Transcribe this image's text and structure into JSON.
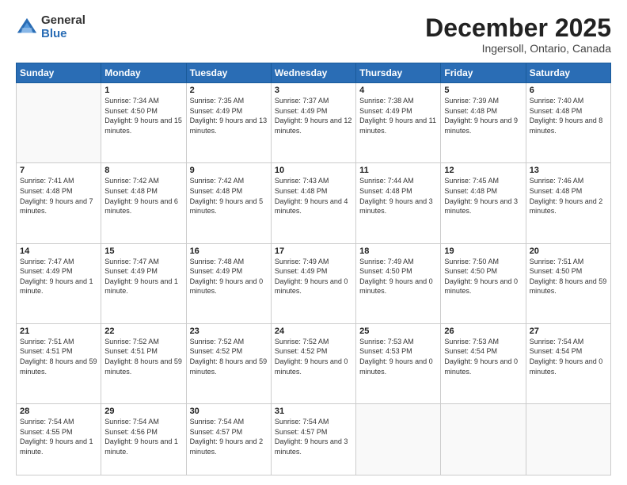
{
  "logo": {
    "general": "General",
    "blue": "Blue"
  },
  "title": "December 2025",
  "subtitle": "Ingersoll, Ontario, Canada",
  "weekdays": [
    "Sunday",
    "Monday",
    "Tuesday",
    "Wednesday",
    "Thursday",
    "Friday",
    "Saturday"
  ],
  "weeks": [
    [
      {
        "day": "",
        "sunrise": "",
        "sunset": "",
        "daylight": ""
      },
      {
        "day": "1",
        "sunrise": "Sunrise: 7:34 AM",
        "sunset": "Sunset: 4:50 PM",
        "daylight": "Daylight: 9 hours and 15 minutes."
      },
      {
        "day": "2",
        "sunrise": "Sunrise: 7:35 AM",
        "sunset": "Sunset: 4:49 PM",
        "daylight": "Daylight: 9 hours and 13 minutes."
      },
      {
        "day": "3",
        "sunrise": "Sunrise: 7:37 AM",
        "sunset": "Sunset: 4:49 PM",
        "daylight": "Daylight: 9 hours and 12 minutes."
      },
      {
        "day": "4",
        "sunrise": "Sunrise: 7:38 AM",
        "sunset": "Sunset: 4:49 PM",
        "daylight": "Daylight: 9 hours and 11 minutes."
      },
      {
        "day": "5",
        "sunrise": "Sunrise: 7:39 AM",
        "sunset": "Sunset: 4:48 PM",
        "daylight": "Daylight: 9 hours and 9 minutes."
      },
      {
        "day": "6",
        "sunrise": "Sunrise: 7:40 AM",
        "sunset": "Sunset: 4:48 PM",
        "daylight": "Daylight: 9 hours and 8 minutes."
      }
    ],
    [
      {
        "day": "7",
        "sunrise": "Sunrise: 7:41 AM",
        "sunset": "Sunset: 4:48 PM",
        "daylight": "Daylight: 9 hours and 7 minutes."
      },
      {
        "day": "8",
        "sunrise": "Sunrise: 7:42 AM",
        "sunset": "Sunset: 4:48 PM",
        "daylight": "Daylight: 9 hours and 6 minutes."
      },
      {
        "day": "9",
        "sunrise": "Sunrise: 7:42 AM",
        "sunset": "Sunset: 4:48 PM",
        "daylight": "Daylight: 9 hours and 5 minutes."
      },
      {
        "day": "10",
        "sunrise": "Sunrise: 7:43 AM",
        "sunset": "Sunset: 4:48 PM",
        "daylight": "Daylight: 9 hours and 4 minutes."
      },
      {
        "day": "11",
        "sunrise": "Sunrise: 7:44 AM",
        "sunset": "Sunset: 4:48 PM",
        "daylight": "Daylight: 9 hours and 3 minutes."
      },
      {
        "day": "12",
        "sunrise": "Sunrise: 7:45 AM",
        "sunset": "Sunset: 4:48 PM",
        "daylight": "Daylight: 9 hours and 3 minutes."
      },
      {
        "day": "13",
        "sunrise": "Sunrise: 7:46 AM",
        "sunset": "Sunset: 4:48 PM",
        "daylight": "Daylight: 9 hours and 2 minutes."
      }
    ],
    [
      {
        "day": "14",
        "sunrise": "Sunrise: 7:47 AM",
        "sunset": "Sunset: 4:49 PM",
        "daylight": "Daylight: 9 hours and 1 minute."
      },
      {
        "day": "15",
        "sunrise": "Sunrise: 7:47 AM",
        "sunset": "Sunset: 4:49 PM",
        "daylight": "Daylight: 9 hours and 1 minute."
      },
      {
        "day": "16",
        "sunrise": "Sunrise: 7:48 AM",
        "sunset": "Sunset: 4:49 PM",
        "daylight": "Daylight: 9 hours and 0 minutes."
      },
      {
        "day": "17",
        "sunrise": "Sunrise: 7:49 AM",
        "sunset": "Sunset: 4:49 PM",
        "daylight": "Daylight: 9 hours and 0 minutes."
      },
      {
        "day": "18",
        "sunrise": "Sunrise: 7:49 AM",
        "sunset": "Sunset: 4:50 PM",
        "daylight": "Daylight: 9 hours and 0 minutes."
      },
      {
        "day": "19",
        "sunrise": "Sunrise: 7:50 AM",
        "sunset": "Sunset: 4:50 PM",
        "daylight": "Daylight: 9 hours and 0 minutes."
      },
      {
        "day": "20",
        "sunrise": "Sunrise: 7:51 AM",
        "sunset": "Sunset: 4:50 PM",
        "daylight": "Daylight: 8 hours and 59 minutes."
      }
    ],
    [
      {
        "day": "21",
        "sunrise": "Sunrise: 7:51 AM",
        "sunset": "Sunset: 4:51 PM",
        "daylight": "Daylight: 8 hours and 59 minutes."
      },
      {
        "day": "22",
        "sunrise": "Sunrise: 7:52 AM",
        "sunset": "Sunset: 4:51 PM",
        "daylight": "Daylight: 8 hours and 59 minutes."
      },
      {
        "day": "23",
        "sunrise": "Sunrise: 7:52 AM",
        "sunset": "Sunset: 4:52 PM",
        "daylight": "Daylight: 8 hours and 59 minutes."
      },
      {
        "day": "24",
        "sunrise": "Sunrise: 7:52 AM",
        "sunset": "Sunset: 4:52 PM",
        "daylight": "Daylight: 9 hours and 0 minutes."
      },
      {
        "day": "25",
        "sunrise": "Sunrise: 7:53 AM",
        "sunset": "Sunset: 4:53 PM",
        "daylight": "Daylight: 9 hours and 0 minutes."
      },
      {
        "day": "26",
        "sunrise": "Sunrise: 7:53 AM",
        "sunset": "Sunset: 4:54 PM",
        "daylight": "Daylight: 9 hours and 0 minutes."
      },
      {
        "day": "27",
        "sunrise": "Sunrise: 7:54 AM",
        "sunset": "Sunset: 4:54 PM",
        "daylight": "Daylight: 9 hours and 0 minutes."
      }
    ],
    [
      {
        "day": "28",
        "sunrise": "Sunrise: 7:54 AM",
        "sunset": "Sunset: 4:55 PM",
        "daylight": "Daylight: 9 hours and 1 minute."
      },
      {
        "day": "29",
        "sunrise": "Sunrise: 7:54 AM",
        "sunset": "Sunset: 4:56 PM",
        "daylight": "Daylight: 9 hours and 1 minute."
      },
      {
        "day": "30",
        "sunrise": "Sunrise: 7:54 AM",
        "sunset": "Sunset: 4:57 PM",
        "daylight": "Daylight: 9 hours and 2 minutes."
      },
      {
        "day": "31",
        "sunrise": "Sunrise: 7:54 AM",
        "sunset": "Sunset: 4:57 PM",
        "daylight": "Daylight: 9 hours and 3 minutes."
      },
      {
        "day": "",
        "sunrise": "",
        "sunset": "",
        "daylight": ""
      },
      {
        "day": "",
        "sunrise": "",
        "sunset": "",
        "daylight": ""
      },
      {
        "day": "",
        "sunrise": "",
        "sunset": "",
        "daylight": ""
      }
    ]
  ]
}
